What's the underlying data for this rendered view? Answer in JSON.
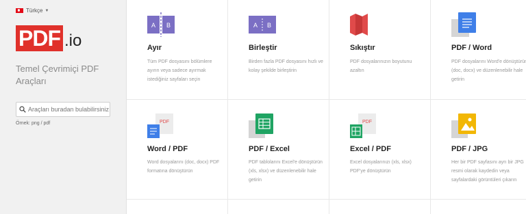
{
  "language": {
    "label": "Türkçe"
  },
  "logo": {
    "main": "PDF",
    "suffix": ".io"
  },
  "tagline": "Temel Çevrimiçi PDF Araçları",
  "search": {
    "placeholder": "Araçları buradan bulabilirsiniz",
    "value": ""
  },
  "example": "Örnek: png / pdf",
  "tools": [
    {
      "title": "Ayır",
      "desc": "Tüm PDF dosyasını bölümlere ayırın veya sadece ayırmak istediğiniz sayfaları seçin",
      "icon": "split-icon",
      "color": "#7b6fc4"
    },
    {
      "title": "Birleştir",
      "desc": "Birden fazla PDF dosyasını hızlı ve kolay şekilde birleştirin",
      "icon": "merge-icon",
      "color": "#7b6fc4"
    },
    {
      "title": "Sıkıştır",
      "desc": "PDF dosyalarınızın boyutunu azaltın",
      "icon": "compress-icon",
      "color": "#e04a4a"
    },
    {
      "title": "PDF / Word",
      "desc": "PDF dosyalarını Word'e dönüştürün (doc, docx) ve düzenlenebilir hale getirin",
      "icon": "word-document-icon",
      "color": "#3f7fe8"
    },
    {
      "title": "Word / PDF",
      "desc": "Word dosyalarını (doc, docx) PDF formatına dönüştürün",
      "icon": "word-to-pdf-icon",
      "color": "#3f7fe8"
    },
    {
      "title": "PDF / Excel",
      "desc": "PDF tablolarını Excel'e dönüştürün (xls, xlsx) ve düzenlenebilir hale getirin",
      "icon": "excel-sheet-icon",
      "color": "#1fa463"
    },
    {
      "title": "Excel / PDF",
      "desc": "Excel dosyalarınızı (xls, xlsx) PDF'ye dönüştürün",
      "icon": "excel-to-pdf-icon",
      "color": "#1fa463"
    },
    {
      "title": "PDF / JPG",
      "desc": "Her bir PDF sayfasını ayrı bir JPG resmi olarak kaydedin veya sayfalardaki görüntüleri çıkarın",
      "icon": "image-icon",
      "color": "#f2b705"
    }
  ],
  "icon_labels": {
    "a": "A",
    "b": "B",
    "pdf": "PDF"
  },
  "colors": {
    "brand": "#e0312b",
    "sidebar": "#f1f1f1"
  }
}
